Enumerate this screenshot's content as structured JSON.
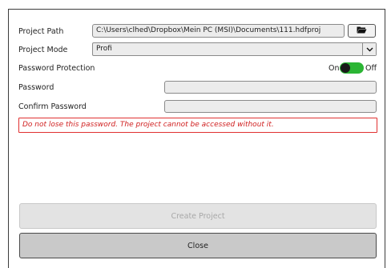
{
  "form": {
    "project_path_label": "Project Path",
    "project_path_value": "C:\\Users\\clhed\\Dropbox\\Mein PC (MSI)\\Documents\\111.hdfproj",
    "project_mode_label": "Project Mode",
    "project_mode_value": "Profi",
    "password_protection_label": "Password Protection",
    "toggle_on_label": "On",
    "toggle_off_label": "Off",
    "toggle_state": "on",
    "password_label": "Password",
    "password_value": "",
    "confirm_password_label": "Confirm Password",
    "confirm_password_value": "",
    "warning_text": "Do not lose this password. The project cannot be accessed without it."
  },
  "buttons": {
    "create_project": "Create Project",
    "close": "Close"
  },
  "icons": {
    "browse": "folder-open-icon",
    "dropdown": "chevron-down-icon"
  },
  "colors": {
    "toggle_on": "#2bb534",
    "warning": "#d02020"
  }
}
